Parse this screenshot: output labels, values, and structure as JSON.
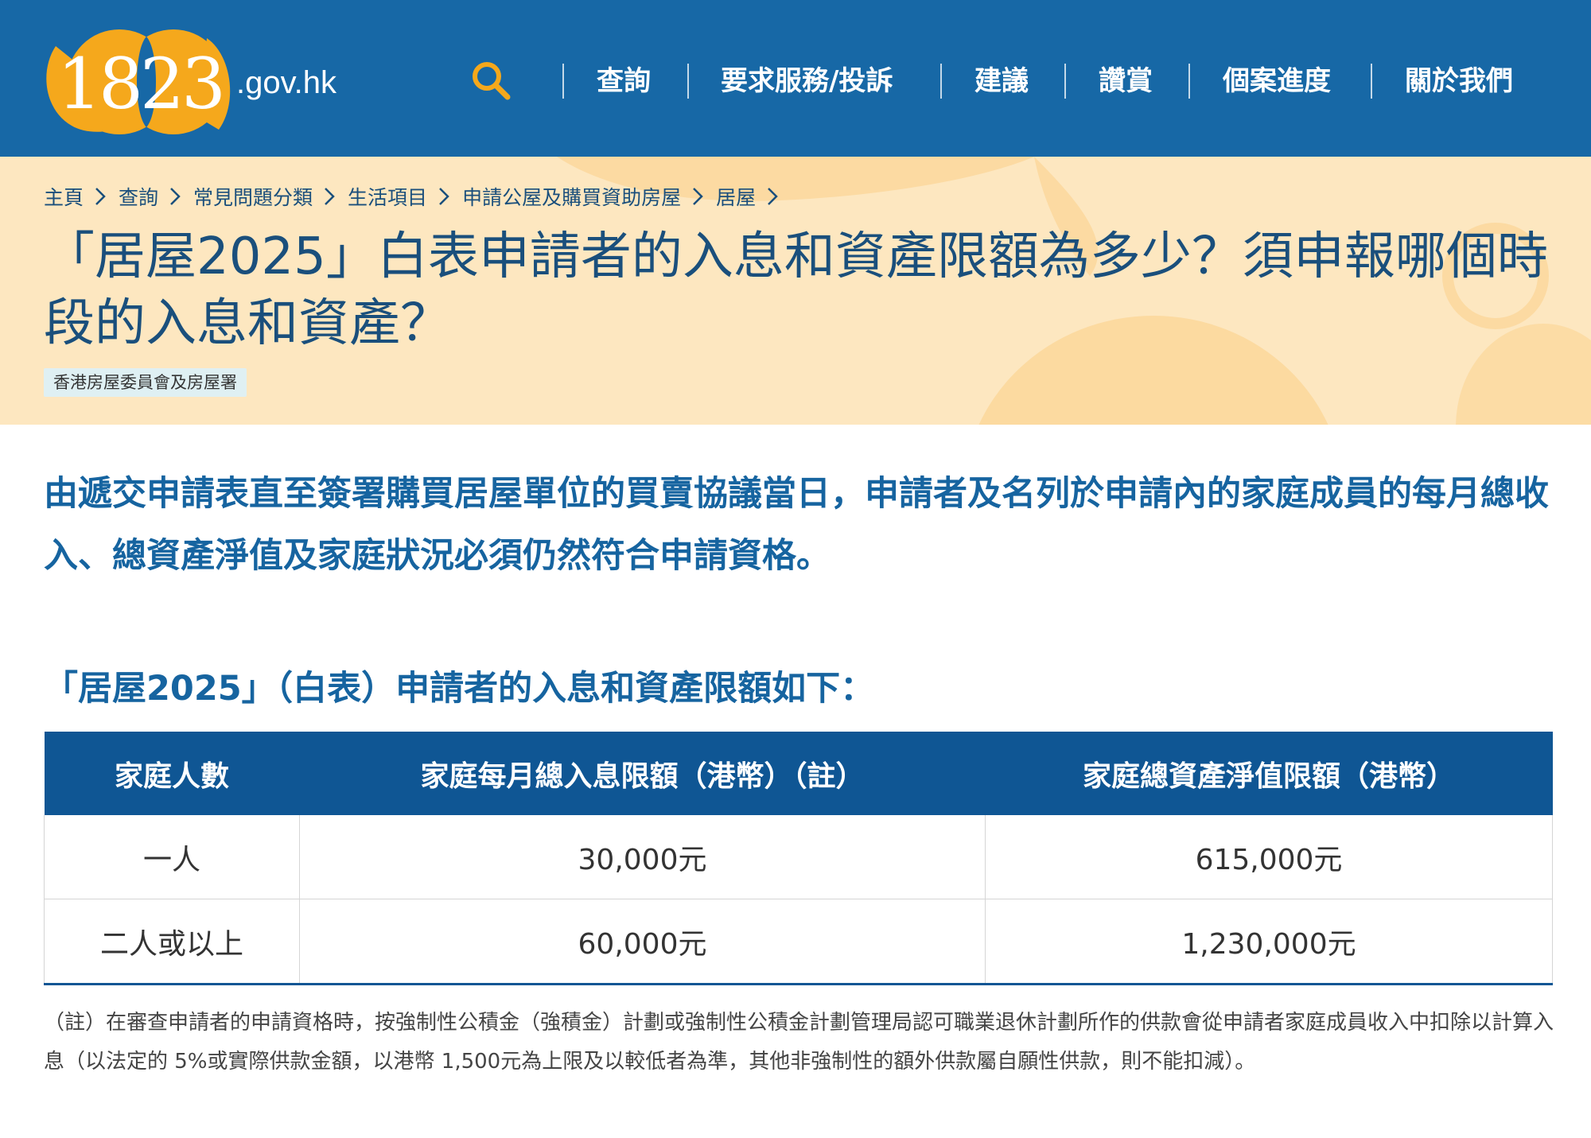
{
  "header": {
    "logo_number": "1823",
    "logo_domain": ".gov.hk",
    "nav": [
      "查詢",
      "要求服務/投訴",
      "建議",
      "讚賞",
      "個案進度",
      "關於我們"
    ],
    "search_icon": "search-icon"
  },
  "breadcrumb": [
    "主頁",
    "查詢",
    "常見問題分類",
    "生活項目",
    "申請公屋及購買資助房屋",
    "居屋"
  ],
  "page_title": "「居屋2025」白表申請者的入息和資產限額為多少？須申報哪個時段的入息和資產？",
  "source": "香港房屋委員會及房屋署",
  "lead": "由遞交申請表直至簽署購買居屋單位的買賣協議當日，申請者及名列於申請內的家庭成員的每月總收入、總資產淨值及家庭狀況必須仍然符合申請資格。",
  "sub_heading": "「居屋2025」（白表）申請者的入息和資產限額如下：",
  "table": {
    "headers": [
      "家庭人數",
      "家庭每月總入息限額（港幣）（註）",
      "家庭總資產淨值限額（港幣）"
    ],
    "rows": [
      [
        "一人",
        "30,000元",
        "615,000元"
      ],
      [
        "二人或以上",
        "60,000元",
        "1,230,000元"
      ]
    ]
  },
  "footnote": "（註）在審查申請者的申請資格時，按強制性公積金（強積金）計劃或強制性公積金計劃管理局認可職業退休計劃所作的供款會從申請者家庭成員收入中扣除以計算入息（以法定的 5%或實際供款金額，以港幣 1,500元為上限及以較低者為準，其他非強制性的額外供款屬自願性供款，則不能扣減）。",
  "colors": {
    "header_bg": "#1768a6",
    "hero_bg": "#fde7c0",
    "accent_blue": "#1664a0",
    "table_header": "#0f5694",
    "logo_orange": "#f5a81c"
  }
}
